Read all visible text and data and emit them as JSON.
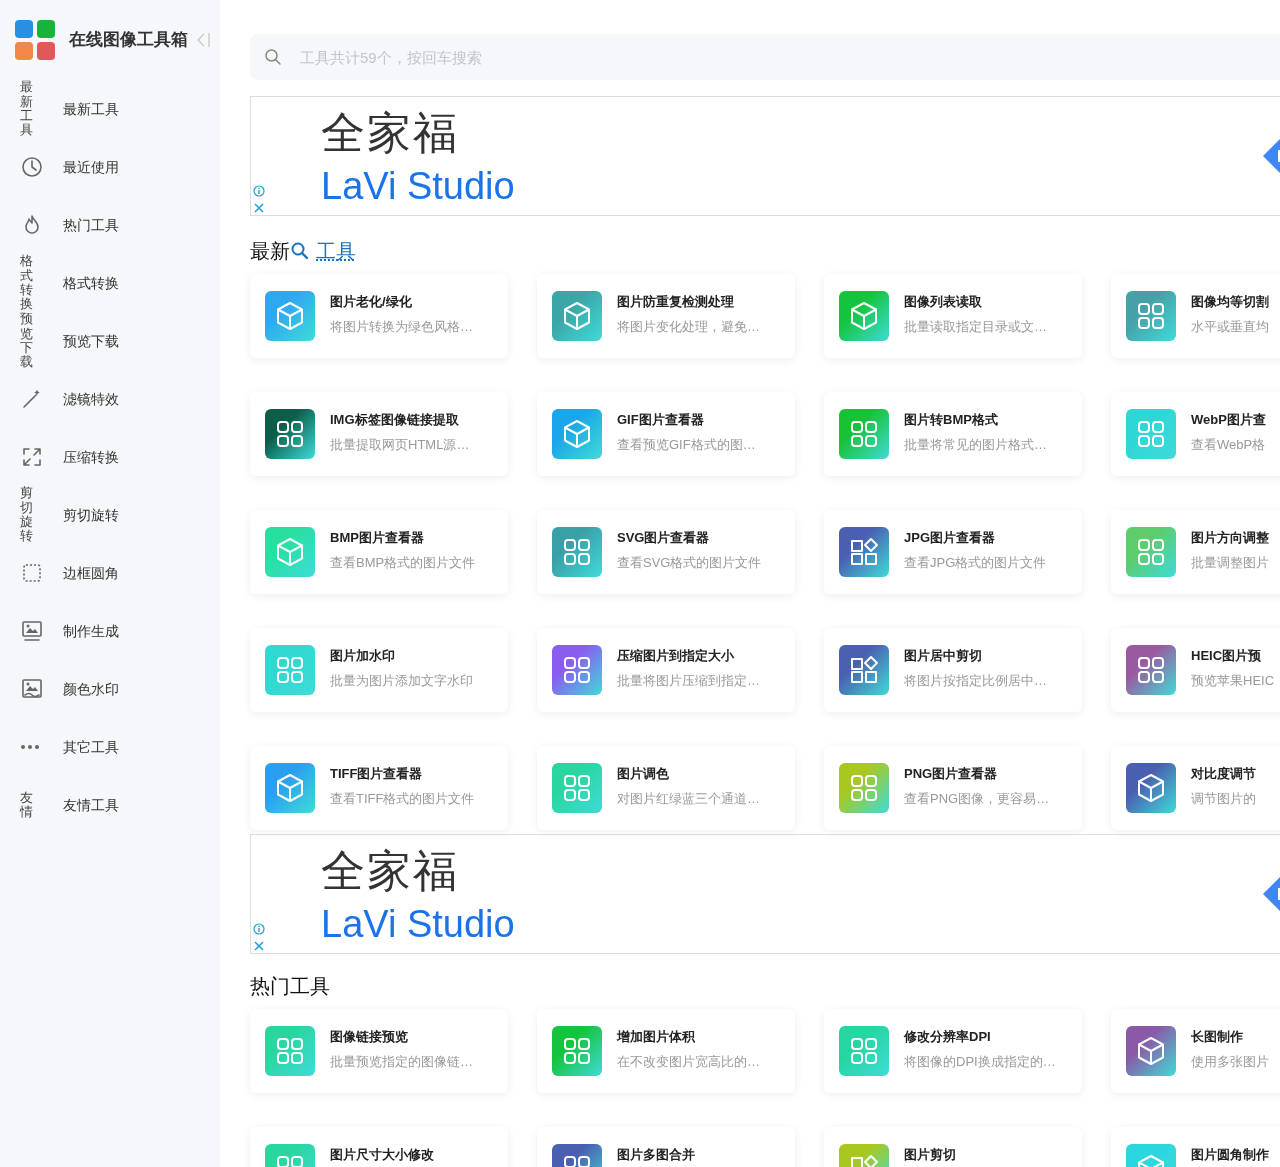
{
  "sidebar": {
    "title": "在线图像工具箱",
    "items": [
      {
        "kind": "alt_text",
        "alt": "最新工具",
        "label": "最新工具"
      },
      {
        "kind": "icon",
        "label": "最近使用"
      },
      {
        "kind": "icon",
        "label": "热门工具"
      },
      {
        "kind": "alt_text",
        "alt": "格式转换",
        "label": "格式转换"
      },
      {
        "kind": "alt_text",
        "alt": "预览下载",
        "label": "预览下载"
      },
      {
        "kind": "icon",
        "label": "滤镜特效"
      },
      {
        "kind": "icon",
        "label": "压缩转换"
      },
      {
        "kind": "alt_text",
        "alt": "剪切旋转",
        "label": "剪切旋转"
      },
      {
        "kind": "icon",
        "label": "边框圆角"
      },
      {
        "kind": "icon",
        "label": "制作生成"
      },
      {
        "kind": "icon",
        "label": "颜色水印"
      },
      {
        "kind": "icon",
        "label": "其它工具"
      },
      {
        "kind": "alt_text",
        "alt": "友情",
        "label": "友情工具"
      }
    ]
  },
  "search": {
    "placeholder": "工具共计59个，按回车搜索"
  },
  "sections": [
    {
      "kind": "ad",
      "headline": "全家福",
      "brand": "LaVi Studio"
    },
    {
      "kind": "tools",
      "title": "最新",
      "link": "工具",
      "cards": [
        {
          "kind": "cube",
          "color": "#2fa8f0",
          "title": "图片老化/绿化",
          "desc": "将图片转换为绿色风格…"
        },
        {
          "kind": "cube",
          "color": "#3aa6a6",
          "title": "图片防重复检测处理",
          "desc": "将图片变化处理，避免…"
        },
        {
          "kind": "cube",
          "color": "#14c43c",
          "title": "图像列表读取",
          "desc": "批量读取指定目录或文…"
        },
        {
          "kind": "grid",
          "color": "#46a0a8",
          "title": "图像均等切割",
          "desc": "水平或垂直均"
        },
        {
          "kind": "grid",
          "color": "#0b5e4a",
          "title": "IMG标签图像链接提取",
          "desc": "批量提取网页HTML源…"
        },
        {
          "kind": "cube",
          "color": "#1aa6e8",
          "title": "GIF图片查看器",
          "desc": "查看预览GIF格式的图…"
        },
        {
          "kind": "grid",
          "color": "#17c235",
          "title": "图片转BMP格式",
          "desc": "批量将常见的图片格式…"
        },
        {
          "kind": "grid",
          "color": "#2ed6d6",
          "title": "WebP图片查",
          "desc": "查看WebP格"
        },
        {
          "kind": "cube",
          "color": "#27e0a0",
          "title": "BMP图片查看器",
          "desc": "查看BMP格式的图片文件"
        },
        {
          "kind": "grid",
          "color": "#3aa0a8",
          "title": "SVG图片查看器",
          "desc": "查看SVG格式的图片文件"
        },
        {
          "kind": "shapes",
          "color": "#4a5fb0",
          "title": "JPG图片查看器",
          "desc": "查看JPG格式的图片文件"
        },
        {
          "kind": "grid",
          "color": "#5dcc6a",
          "title": "图片方向调整",
          "desc": "批量调整图片"
        },
        {
          "kind": "grid",
          "color": "#2fd8d0",
          "title": "图片加水印",
          "desc": "批量为图片添加文字水印"
        },
        {
          "kind": "grid",
          "color": "#8a5cf0",
          "title": "压缩图片到指定大小",
          "desc": "批量将图片压缩到指定…"
        },
        {
          "kind": "shapes",
          "color": "#4a60b0",
          "title": "图片居中剪切",
          "desc": "将图片按指定比例居中…"
        },
        {
          "kind": "grid",
          "color": "#9a5aa0",
          "title": "HEIC图片预",
          "desc": "预览苹果HEIC"
        },
        {
          "kind": "cube",
          "color": "#2a9ef0",
          "title": "TIFF图片查看器",
          "desc": "查看TIFF格式的图片文件"
        },
        {
          "kind": "grid",
          "color": "#2ad6a0",
          "title": "图片调色",
          "desc": "对图片红绿蓝三个通道…"
        },
        {
          "kind": "grid",
          "color": "#a8c820",
          "title": "PNG图片查看器",
          "desc": "查看PNG图像，更容易…"
        },
        {
          "kind": "cube",
          "color": "#4a5fb0",
          "title": "对比度调节",
          "desc": "调节图片的"
        }
      ]
    },
    {
      "kind": "ad",
      "headline": "全家福",
      "brand": "LaVi Studio"
    },
    {
      "kind": "tools",
      "title": "热门工具",
      "cards": [
        {
          "kind": "grid",
          "color": "#2ad6a0",
          "title": "图像链接预览",
          "desc": "批量预览指定的图像链…"
        },
        {
          "kind": "grid",
          "color": "#14c43c",
          "title": "增加图片体积",
          "desc": "在不改变图片宽高比的…"
        },
        {
          "kind": "grid",
          "color": "#25d6a0",
          "title": "修改分辨率DPI",
          "desc": "将图像的DPI换成指定的…"
        },
        {
          "kind": "cube",
          "color": "#8a5aa8",
          "title": "长图制作",
          "desc": "使用多张图片"
        },
        {
          "kind": "grid",
          "color": "#2ad6a0",
          "title": "图片尺寸大小修改"
        },
        {
          "kind": "grid",
          "color": "#4a5fb0",
          "title": "图片多图合并"
        },
        {
          "kind": "shapes",
          "color": "#a8c820",
          "title": "图片剪切"
        },
        {
          "kind": "cube",
          "color": "#2ad6e0",
          "title": "图片圆角制作"
        }
      ]
    }
  ]
}
